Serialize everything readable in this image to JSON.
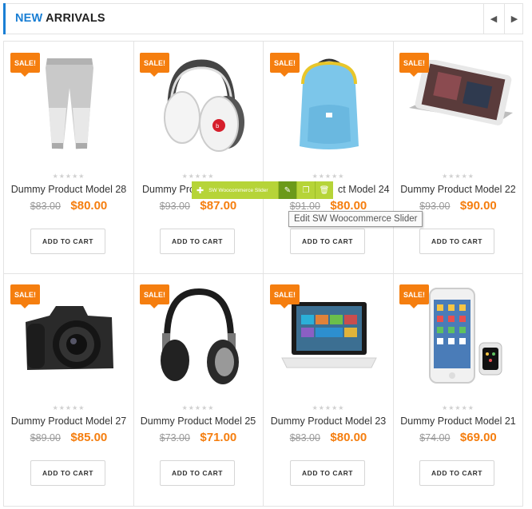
{
  "header": {
    "title_highlight": "NEW",
    "title_rest": "ARRIVALS",
    "prev_icon": "chevron-left-icon",
    "next_icon": "chevron-right-icon",
    "accent_color": "#1a7fd4"
  },
  "sale_label": "SALE!",
  "cart_label": "ADD TO CART",
  "sale_color": "#f57e0f",
  "products": [
    {
      "name": "Dummy Product Model 28",
      "old_price": "$83.00",
      "price": "$80.00",
      "image": "sweatpants"
    },
    {
      "name": "Dummy Product Model 26",
      "display_name": "Dummy Produ",
      "old_price": "$93.00",
      "price": "$87.00",
      "image": "headphones-white"
    },
    {
      "name": "Dummy Product Model 24",
      "display_name": "ct Model 24",
      "old_price": "$91.00",
      "price": "$80.00",
      "image": "backpack"
    },
    {
      "name": "Dummy Product Model 22",
      "old_price": "$93.00",
      "price": "$90.00",
      "image": "tablet"
    },
    {
      "name": "Dummy Product Model 27",
      "old_price": "$89.00",
      "price": "$85.00",
      "image": "camera"
    },
    {
      "name": "Dummy Product Model 25",
      "old_price": "$73.00",
      "price": "$71.00",
      "image": "headphones-black"
    },
    {
      "name": "Dummy Product Model 23",
      "old_price": "$83.00",
      "price": "$80.00",
      "image": "laptop"
    },
    {
      "name": "Dummy Product Model 21",
      "old_price": "$74.00",
      "price": "$69.00",
      "image": "phone-watch"
    }
  ],
  "edit_toolbar": {
    "label": "SW Woocommerce Slider",
    "add_icon": "plus-icon",
    "edit_icon": "pencil-icon",
    "clone_icon": "copy-icon",
    "delete_icon": "trash-icon",
    "color": "#b6d438",
    "tooltip": "Edit SW Woocommerce Slider"
  }
}
